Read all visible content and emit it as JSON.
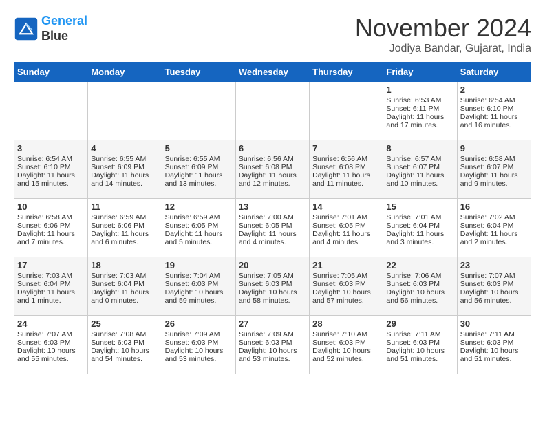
{
  "header": {
    "logo_line1": "General",
    "logo_line2": "Blue",
    "month": "November 2024",
    "location": "Jodiya Bandar, Gujarat, India"
  },
  "weekdays": [
    "Sunday",
    "Monday",
    "Tuesday",
    "Wednesday",
    "Thursday",
    "Friday",
    "Saturday"
  ],
  "weeks": [
    [
      {
        "day": "",
        "text": ""
      },
      {
        "day": "",
        "text": ""
      },
      {
        "day": "",
        "text": ""
      },
      {
        "day": "",
        "text": ""
      },
      {
        "day": "",
        "text": ""
      },
      {
        "day": "1",
        "text": "Sunrise: 6:53 AM\nSunset: 6:11 PM\nDaylight: 11 hours\nand 17 minutes."
      },
      {
        "day": "2",
        "text": "Sunrise: 6:54 AM\nSunset: 6:10 PM\nDaylight: 11 hours\nand 16 minutes."
      }
    ],
    [
      {
        "day": "3",
        "text": "Sunrise: 6:54 AM\nSunset: 6:10 PM\nDaylight: 11 hours\nand 15 minutes."
      },
      {
        "day": "4",
        "text": "Sunrise: 6:55 AM\nSunset: 6:09 PM\nDaylight: 11 hours\nand 14 minutes."
      },
      {
        "day": "5",
        "text": "Sunrise: 6:55 AM\nSunset: 6:09 PM\nDaylight: 11 hours\nand 13 minutes."
      },
      {
        "day": "6",
        "text": "Sunrise: 6:56 AM\nSunset: 6:08 PM\nDaylight: 11 hours\nand 12 minutes."
      },
      {
        "day": "7",
        "text": "Sunrise: 6:56 AM\nSunset: 6:08 PM\nDaylight: 11 hours\nand 11 minutes."
      },
      {
        "day": "8",
        "text": "Sunrise: 6:57 AM\nSunset: 6:07 PM\nDaylight: 11 hours\nand 10 minutes."
      },
      {
        "day": "9",
        "text": "Sunrise: 6:58 AM\nSunset: 6:07 PM\nDaylight: 11 hours\nand 9 minutes."
      }
    ],
    [
      {
        "day": "10",
        "text": "Sunrise: 6:58 AM\nSunset: 6:06 PM\nDaylight: 11 hours\nand 7 minutes."
      },
      {
        "day": "11",
        "text": "Sunrise: 6:59 AM\nSunset: 6:06 PM\nDaylight: 11 hours\nand 6 minutes."
      },
      {
        "day": "12",
        "text": "Sunrise: 6:59 AM\nSunset: 6:05 PM\nDaylight: 11 hours\nand 5 minutes."
      },
      {
        "day": "13",
        "text": "Sunrise: 7:00 AM\nSunset: 6:05 PM\nDaylight: 11 hours\nand 4 minutes."
      },
      {
        "day": "14",
        "text": "Sunrise: 7:01 AM\nSunset: 6:05 PM\nDaylight: 11 hours\nand 4 minutes."
      },
      {
        "day": "15",
        "text": "Sunrise: 7:01 AM\nSunset: 6:04 PM\nDaylight: 11 hours\nand 3 minutes."
      },
      {
        "day": "16",
        "text": "Sunrise: 7:02 AM\nSunset: 6:04 PM\nDaylight: 11 hours\nand 2 minutes."
      }
    ],
    [
      {
        "day": "17",
        "text": "Sunrise: 7:03 AM\nSunset: 6:04 PM\nDaylight: 11 hours\nand 1 minute."
      },
      {
        "day": "18",
        "text": "Sunrise: 7:03 AM\nSunset: 6:04 PM\nDaylight: 11 hours\nand 0 minutes."
      },
      {
        "day": "19",
        "text": "Sunrise: 7:04 AM\nSunset: 6:03 PM\nDaylight: 10 hours\nand 59 minutes."
      },
      {
        "day": "20",
        "text": "Sunrise: 7:05 AM\nSunset: 6:03 PM\nDaylight: 10 hours\nand 58 minutes."
      },
      {
        "day": "21",
        "text": "Sunrise: 7:05 AM\nSunset: 6:03 PM\nDaylight: 10 hours\nand 57 minutes."
      },
      {
        "day": "22",
        "text": "Sunrise: 7:06 AM\nSunset: 6:03 PM\nDaylight: 10 hours\nand 56 minutes."
      },
      {
        "day": "23",
        "text": "Sunrise: 7:07 AM\nSunset: 6:03 PM\nDaylight: 10 hours\nand 56 minutes."
      }
    ],
    [
      {
        "day": "24",
        "text": "Sunrise: 7:07 AM\nSunset: 6:03 PM\nDaylight: 10 hours\nand 55 minutes."
      },
      {
        "day": "25",
        "text": "Sunrise: 7:08 AM\nSunset: 6:03 PM\nDaylight: 10 hours\nand 54 minutes."
      },
      {
        "day": "26",
        "text": "Sunrise: 7:09 AM\nSunset: 6:03 PM\nDaylight: 10 hours\nand 53 minutes."
      },
      {
        "day": "27",
        "text": "Sunrise: 7:09 AM\nSunset: 6:03 PM\nDaylight: 10 hours\nand 53 minutes."
      },
      {
        "day": "28",
        "text": "Sunrise: 7:10 AM\nSunset: 6:03 PM\nDaylight: 10 hours\nand 52 minutes."
      },
      {
        "day": "29",
        "text": "Sunrise: 7:11 AM\nSunset: 6:03 PM\nDaylight: 10 hours\nand 51 minutes."
      },
      {
        "day": "30",
        "text": "Sunrise: 7:11 AM\nSunset: 6:03 PM\nDaylight: 10 hours\nand 51 minutes."
      }
    ]
  ]
}
